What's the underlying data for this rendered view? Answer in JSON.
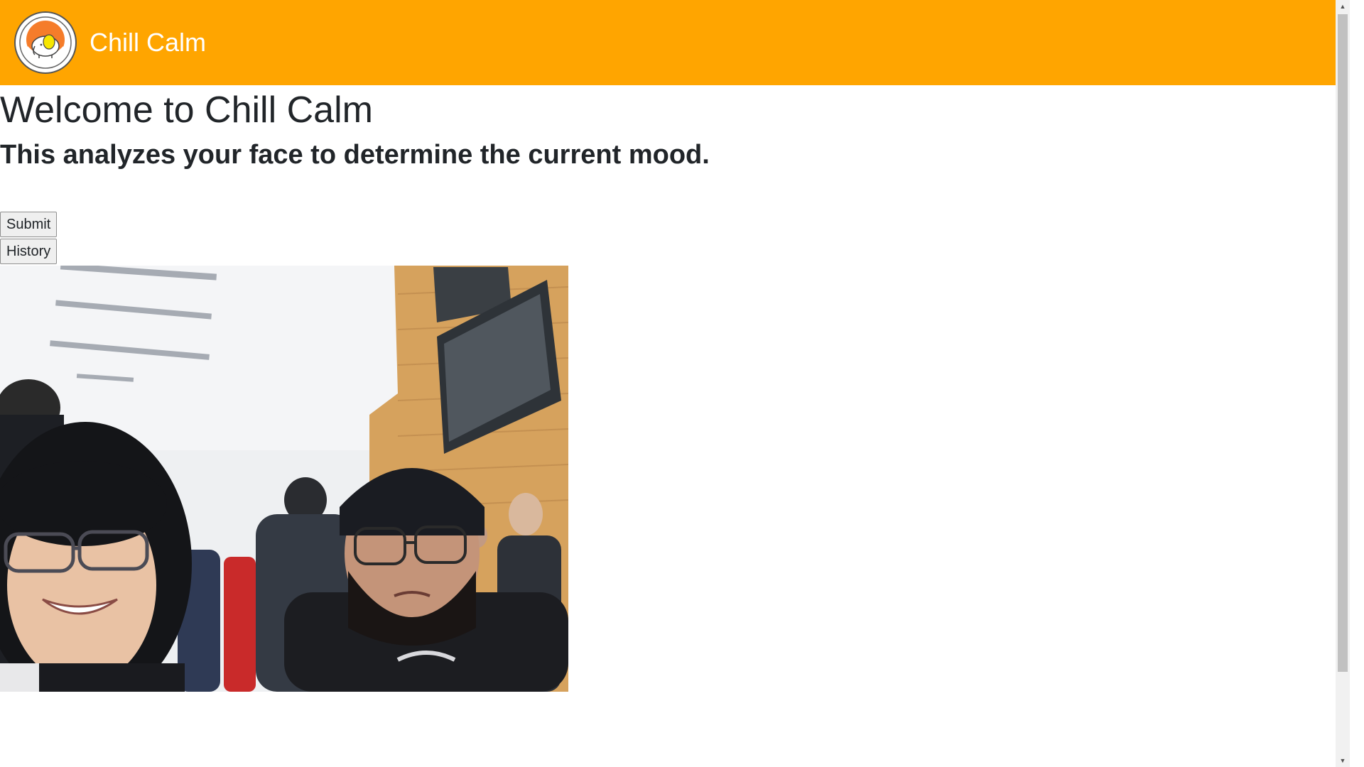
{
  "header": {
    "brand": "Chill Calm",
    "logo_icon": "elephant-logo-icon",
    "background_color": "#FFA500"
  },
  "main": {
    "title": "Welcome to Chill Calm",
    "subtitle": "This analyzes your face to determine the current mood."
  },
  "actions": {
    "submit_label": "Submit",
    "history_label": "History"
  },
  "camera": {
    "description_icon": "webcam-feed-image"
  },
  "scrollbar": {
    "up_icon": "scroll-up-arrow-icon",
    "down_icon": "scroll-down-arrow-icon"
  }
}
